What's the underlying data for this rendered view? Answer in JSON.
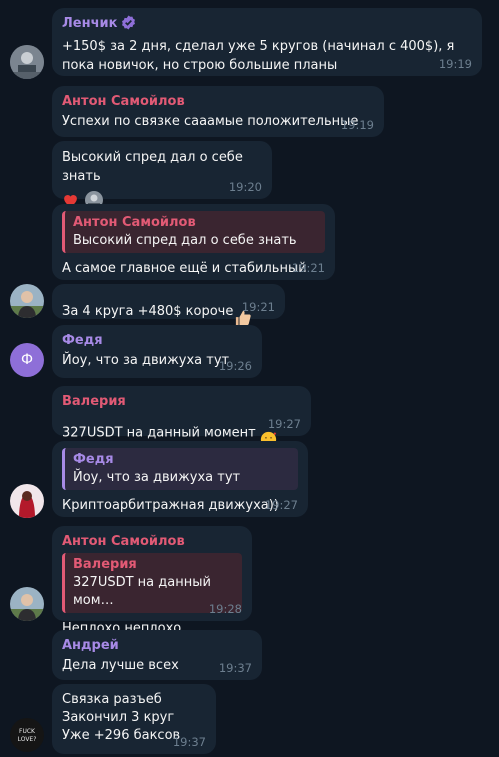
{
  "colors": {
    "background": "#0e1621",
    "bubble": "#182533",
    "name_purple": "#a78ae6",
    "name_pink": "#e25a75",
    "time": "#6d7f8f"
  },
  "messages": [
    {
      "sender": "Ленчик",
      "text": "+150$ за 2 дня, сделал уже 5 кругов (начинал с 400$), я пока новичок, но строю большие планы",
      "time": "19:19"
    },
    {
      "sender": "Антон Самойлов",
      "text": "Успехи по связке сааамые положительные",
      "time": "19:19"
    },
    {
      "text": "Высокий спред дал о себе знать",
      "time": "19:20",
      "reactions": [
        "heart-reaction",
        "avatar-reaction"
      ]
    },
    {
      "reply_name": "Антон Самойлов",
      "reply_text": "Высокий спред дал о себе знать",
      "text": "А самое главное ещё и стабильный",
      "time": "19:21"
    },
    {
      "text": "За 4 круга +480$ короче",
      "time": "19:21"
    },
    {
      "sender": "Федя",
      "avatar_letter": "Ф",
      "text": "Йоу, что за движуха тут",
      "time": "19:26"
    },
    {
      "sender": "Валерия",
      "text": "327USDT на данный момент",
      "time": "19:27"
    },
    {
      "reply_name": "Федя",
      "reply_text": "Йоу, что за движуха тут",
      "text": "Криптоарбитражная движуха))",
      "time": "19:27"
    },
    {
      "sender": "Антон Самойлов",
      "reply_name": "Валерия",
      "reply_text": "327USDT на данный мом…",
      "text": "Неплохо неплохо",
      "time": "19:28"
    },
    {
      "sender": "Андрей",
      "text": "Дела лучше всех",
      "time": "19:37"
    },
    {
      "text": "Связка разъеб\nЗакончил 3 круг\nУже +296 баксов",
      "time": "19:37"
    }
  ]
}
